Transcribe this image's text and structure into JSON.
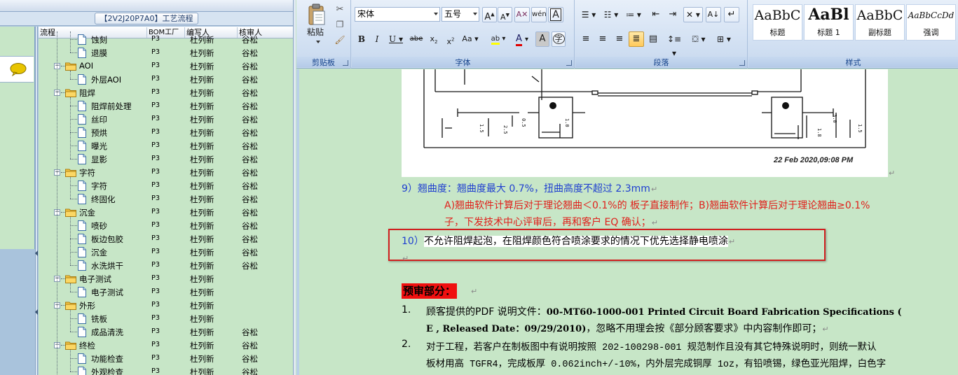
{
  "left_panel": {
    "flow_title": "【2V2J20P7A0】工艺流程",
    "columns": [
      "流程",
      "BOM工厂",
      "编写人",
      "核审人"
    ],
    "rows": [
      {
        "level": 2,
        "type": "file",
        "name": "蚀刻",
        "factory": "P3",
        "writer": "杜列新",
        "reviewer": "谷松"
      },
      {
        "level": 2,
        "type": "file",
        "name": "退膜",
        "factory": "P3",
        "writer": "杜列新",
        "reviewer": "谷松"
      },
      {
        "level": 1,
        "type": "folder",
        "name": "AOI",
        "factory": "P3",
        "writer": "杜列新",
        "reviewer": "谷松"
      },
      {
        "level": 2,
        "type": "file",
        "name": "外层AOI",
        "factory": "P3",
        "writer": "杜列新",
        "reviewer": "谷松"
      },
      {
        "level": 1,
        "type": "folder",
        "name": "阻焊",
        "factory": "P3",
        "writer": "杜列新",
        "reviewer": "谷松"
      },
      {
        "level": 2,
        "type": "file",
        "name": "阻焊前处理",
        "factory": "P3",
        "writer": "杜列新",
        "reviewer": "谷松"
      },
      {
        "level": 2,
        "type": "file",
        "name": "丝印",
        "factory": "P3",
        "writer": "杜列新",
        "reviewer": "谷松"
      },
      {
        "level": 2,
        "type": "file",
        "name": "预烘",
        "factory": "P3",
        "writer": "杜列新",
        "reviewer": "谷松"
      },
      {
        "level": 2,
        "type": "file",
        "name": "曝光",
        "factory": "P3",
        "writer": "杜列新",
        "reviewer": "谷松"
      },
      {
        "level": 2,
        "type": "file",
        "name": "显影",
        "factory": "P3",
        "writer": "杜列新",
        "reviewer": "谷松"
      },
      {
        "level": 1,
        "type": "folder",
        "name": "字符",
        "factory": "P3",
        "writer": "杜列新",
        "reviewer": "谷松"
      },
      {
        "level": 2,
        "type": "file",
        "name": "字符",
        "factory": "P3",
        "writer": "杜列新",
        "reviewer": "谷松"
      },
      {
        "level": 2,
        "type": "file",
        "name": "终固化",
        "factory": "P3",
        "writer": "杜列新",
        "reviewer": "谷松"
      },
      {
        "level": 1,
        "type": "folder",
        "name": "沉金",
        "factory": "P3",
        "writer": "杜列新",
        "reviewer": "谷松"
      },
      {
        "level": 2,
        "type": "file",
        "name": "喷砂",
        "factory": "P3",
        "writer": "杜列新",
        "reviewer": "谷松"
      },
      {
        "level": 2,
        "type": "file",
        "name": "板边包胶",
        "factory": "P3",
        "writer": "杜列新",
        "reviewer": "谷松"
      },
      {
        "level": 2,
        "type": "file",
        "name": "沉金",
        "factory": "P3",
        "writer": "杜列新",
        "reviewer": "谷松"
      },
      {
        "level": 2,
        "type": "file",
        "name": "水洗烘干",
        "factory": "P3",
        "writer": "杜列新",
        "reviewer": "谷松"
      },
      {
        "level": 1,
        "type": "folder",
        "name": "电子测试",
        "factory": "P3",
        "writer": "杜列新",
        "reviewer": ""
      },
      {
        "level": 2,
        "type": "file",
        "name": "电子测试",
        "factory": "P3",
        "writer": "杜列新",
        "reviewer": ""
      },
      {
        "level": 1,
        "type": "folder",
        "name": "外形",
        "factory": "P3",
        "writer": "杜列新",
        "reviewer": ""
      },
      {
        "level": 2,
        "type": "file",
        "name": "铣板",
        "factory": "P3",
        "writer": "杜列新",
        "reviewer": ""
      },
      {
        "level": 2,
        "type": "file",
        "name": "成品清洗",
        "factory": "P3",
        "writer": "杜列新",
        "reviewer": "谷松"
      },
      {
        "level": 1,
        "type": "folder",
        "name": "终检",
        "factory": "P3",
        "writer": "杜列新",
        "reviewer": "谷松"
      },
      {
        "level": 2,
        "type": "file",
        "name": "功能检查",
        "factory": "P3",
        "writer": "杜列新",
        "reviewer": "谷松"
      },
      {
        "level": 2,
        "type": "file",
        "name": "外观检查",
        "factory": "P3",
        "writer": "杜列新",
        "reviewer": "谷松"
      }
    ]
  },
  "ribbon": {
    "clipboard": {
      "paste": "粘贴",
      "label": "剪贴板"
    },
    "font": {
      "name": "宋体",
      "size": "五号",
      "label": "字体"
    },
    "paragraph": {
      "label": "段落"
    },
    "styles": {
      "label": "样式",
      "items": [
        {
          "sample": "AaBbC",
          "name": "标题"
        },
        {
          "sample": "AaBl",
          "name": "标题 1"
        },
        {
          "sample": "AaBbC",
          "name": "副标题"
        },
        {
          "sample": "AaBbCcDd",
          "name": "强调"
        }
      ]
    }
  },
  "document": {
    "figure_timestamp": "22 Feb 2020,09:08 PM",
    "item9_prefix": "9）翘曲度：",
    "item9_text": "翘曲度最大 0.7%，扭曲高度不超过 2.3mm",
    "item9_sub1": "A)翘曲软件计算后对于理论翘曲＜0.1%的 板子直接制作；B)翘曲软件计算后对于理论翘曲≥0.1%",
    "item9_sub2": "子，下发技术中心评审后，再和客户 EQ 确认；",
    "item10_num": "10）",
    "item10_text": "不允许阻焊起泡，在阻焊颜色符合喷涂要求的情况下优先选择静电喷涂",
    "review_heading": "预审部分：",
    "list": [
      {
        "num": "1.",
        "line1_a": "顾客提供的PDF 说明文件：",
        "line1_b": "00-MT60-1000-001 Printed Circuit Board Fabrication Specifications (",
        "line2_a": "E , Released Date：09/29/2010)",
        "line2_b": "，忽略不用理会按《部分顾客要求》中内容制作即可；"
      },
      {
        "num": "2.",
        "line1_a": "对于工程，若客户在制板图中有说明按照 202-100298-001 规范制作且没有其它特殊说明时，则统一默认",
        "line2_a": "板材用高 TGFR4，完成板厚 0.062inch+/-10%，内外层完成铜厚 1oz，有铅喷锡，绿色亚光阻焊，白色字"
      }
    ]
  }
}
